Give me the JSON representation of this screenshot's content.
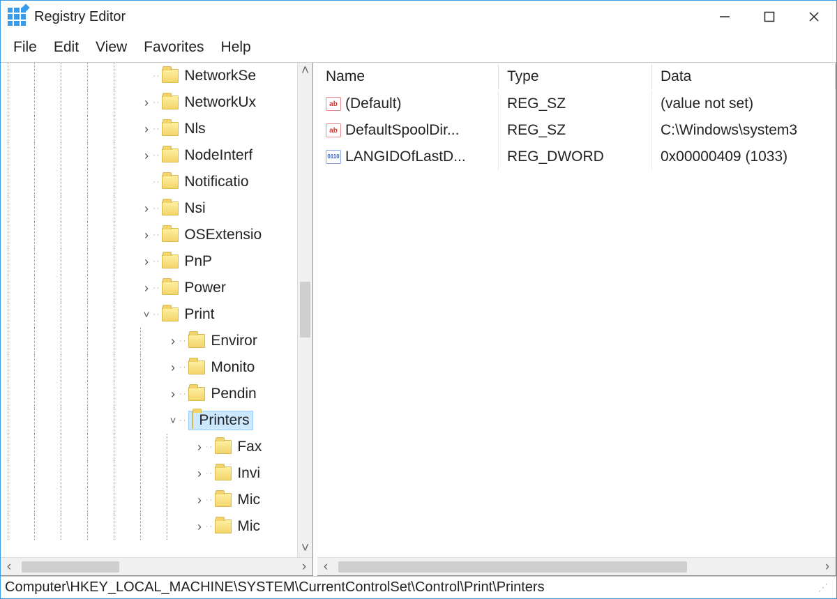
{
  "window_title": "Registry Editor",
  "menu": [
    "File",
    "Edit",
    "View",
    "Favorites",
    "Help"
  ],
  "tree": {
    "items": [
      {
        "level": 1,
        "exp": "",
        "label": "NetworkSe",
        "sel": false,
        "dots": true
      },
      {
        "level": 1,
        "exp": ">",
        "label": "NetworkUx",
        "sel": false,
        "dots": true
      },
      {
        "level": 1,
        "exp": ">",
        "label": "Nls",
        "sel": false,
        "dots": true
      },
      {
        "level": 1,
        "exp": ">",
        "label": "NodeInterf",
        "sel": false,
        "dots": true
      },
      {
        "level": 1,
        "exp": "",
        "label": "Notificatio",
        "sel": false,
        "dots": true
      },
      {
        "level": 1,
        "exp": ">",
        "label": "Nsi",
        "sel": false,
        "dots": true
      },
      {
        "level": 1,
        "exp": ">",
        "label": "OSExtensio",
        "sel": false,
        "dots": true
      },
      {
        "level": 1,
        "exp": ">",
        "label": "PnP",
        "sel": false,
        "dots": true
      },
      {
        "level": 1,
        "exp": ">",
        "label": "Power",
        "sel": false,
        "dots": true
      },
      {
        "level": 1,
        "exp": "v",
        "label": "Print",
        "sel": false,
        "dots": true
      },
      {
        "level": 2,
        "exp": ">",
        "label": "Enviror",
        "sel": false,
        "dots": true
      },
      {
        "level": 2,
        "exp": ">",
        "label": "Monito",
        "sel": false,
        "dots": true
      },
      {
        "level": 2,
        "exp": ">",
        "label": "Pendin",
        "sel": false,
        "dots": true
      },
      {
        "level": 2,
        "exp": "v",
        "label": "Printers",
        "sel": true,
        "dots": true
      },
      {
        "level": 3,
        "exp": ">",
        "label": "Fax",
        "sel": false,
        "dots": true
      },
      {
        "level": 3,
        "exp": ">",
        "label": "Invi",
        "sel": false,
        "dots": true
      },
      {
        "level": 3,
        "exp": ">",
        "label": "Mic",
        "sel": false,
        "dots": true
      },
      {
        "level": 3,
        "exp": ">",
        "label": "Mic",
        "sel": false,
        "dots": true
      }
    ]
  },
  "columns": {
    "name": "Name",
    "type": "Type",
    "data": "Data"
  },
  "values": [
    {
      "icon": "sz",
      "name": "(Default)",
      "type": "REG_SZ",
      "data": "(value not set)"
    },
    {
      "icon": "sz",
      "name": "DefaultSpoolDir...",
      "type": "REG_SZ",
      "data": "C:\\Windows\\system3"
    },
    {
      "icon": "dw",
      "name": "LANGIDOfLastD...",
      "type": "REG_DWORD",
      "data": "0x00000409 (1033)"
    }
  ],
  "status_path": "Computer\\HKEY_LOCAL_MACHINE\\SYSTEM\\CurrentControlSet\\Control\\Print\\Printers",
  "icon_text": {
    "sz": "ab",
    "dw": "011\n110"
  }
}
